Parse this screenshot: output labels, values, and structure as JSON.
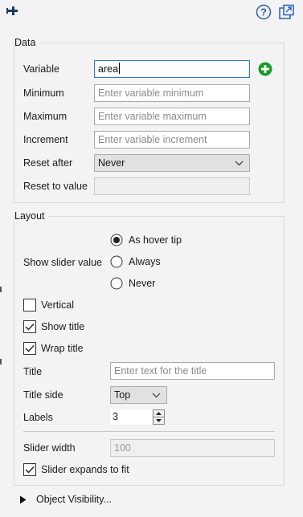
{
  "data_section": {
    "title": "Data",
    "variable": {
      "label": "Variable",
      "value": "area"
    },
    "minimum": {
      "label": "Minimum",
      "placeholder": "Enter variable minimum"
    },
    "maximum": {
      "label": "Maximum",
      "placeholder": "Enter variable maximum"
    },
    "increment": {
      "label": "Increment",
      "placeholder": "Enter variable increment"
    },
    "reset_after": {
      "label": "Reset after",
      "value": "Never"
    },
    "reset_to_value": {
      "label": "Reset to value",
      "value": ""
    }
  },
  "layout_section": {
    "title": "Layout",
    "show_slider_value": {
      "label": "Show slider value",
      "options": [
        {
          "label": "As hover tip",
          "selected": true
        },
        {
          "label": "Always",
          "selected": false
        },
        {
          "label": "Never",
          "selected": false
        }
      ]
    },
    "vertical": {
      "label": "Vertical",
      "checked": false
    },
    "show_title": {
      "label": "Show title",
      "checked": true
    },
    "wrap_title": {
      "label": "Wrap title",
      "checked": true
    },
    "title_field": {
      "label": "Title",
      "placeholder": "Enter text for the title"
    },
    "title_side": {
      "label": "Title side",
      "value": "Top"
    },
    "labels": {
      "label": "Labels",
      "value": "3"
    },
    "slider_width": {
      "label": "Slider width",
      "value": "100"
    },
    "slider_expands": {
      "label": "Slider expands to fit",
      "checked": true
    }
  },
  "object_visibility": {
    "label": "Object Visibility..."
  },
  "colors": {
    "add_green": "#1a9a2a",
    "help_blue": "#2a5fb5",
    "focus_blue": "#2b78d4"
  }
}
